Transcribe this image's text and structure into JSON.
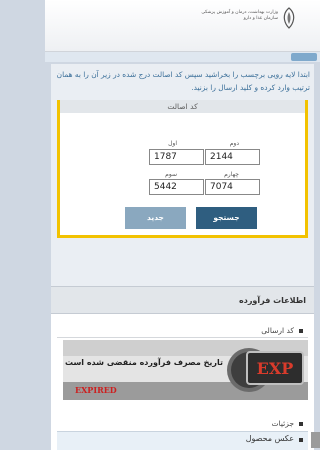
{
  "header": {
    "ministry_line1": "وزارت بهداشت، درمان و آموزش پزشکی",
    "ministry_line2": "سازمان غذا و دارو"
  },
  "instructions": "ابتدا لایه رویی برچسب را بخراشید سپس کد اصالت درج شده در زیر آن را به همان ترتیب وارد کرده و کلید ارسال را بزنید.",
  "auth_form": {
    "title": "کد اصالت",
    "fields": {
      "first": {
        "label": "اول",
        "value": "1787"
      },
      "second": {
        "label": "دوم",
        "value": "2144"
      },
      "third": {
        "label": "سوم",
        "value": "5442"
      },
      "fourth": {
        "label": "چهارم",
        "value": "7074"
      }
    },
    "search_button": "جستجو",
    "new_button": "جدید"
  },
  "product_info": {
    "title": "اطلاعات فرآورده",
    "sent_code_label": "کد ارسالی",
    "expired_message": "تاریخ مصرف فرآورده منقضی شده است",
    "expired_word": "EXPIRED",
    "exp_badge": "EXP",
    "details_label": "جزئیات",
    "product_photo_label": "عکس محصول"
  },
  "colors": {
    "accent_yellow": "#f2c200",
    "primary_button": "#2f5e80",
    "secondary_button": "#8aa8bf",
    "instruction_text": "#3b6f99",
    "expired_red": "#cc2020"
  }
}
